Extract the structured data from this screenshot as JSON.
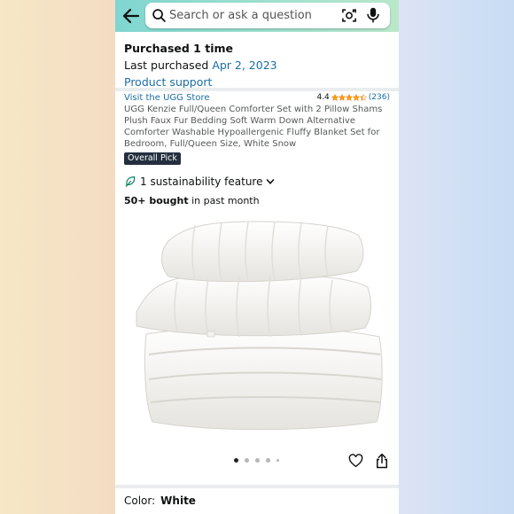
{
  "search": {
    "placeholder": "Search or ask a question",
    "value": ""
  },
  "purchase": {
    "count_text": "Purchased 1 time",
    "last_label": "Last purchased",
    "last_date": "Apr 2, 2023",
    "support_link": "Product support"
  },
  "product": {
    "store_link": "Visit the UGG Store",
    "rating_value": "4.4",
    "rating_stars": 4.4,
    "review_count": "(236)",
    "title": "UGG Kenzie Full/Queen Comforter Set with 2 Pillow Shams Plush Faux Fur Bedding Soft Warm Down Alternative Comforter Washable Hypoallergenic Fluffy Blanket Set for Bedroom, Full/Queen Size, White Snow",
    "badge": "Overall Pick",
    "sustainability": "1 sustainability feature",
    "bought_bold": "50+ bought",
    "bought_rest": " in past month"
  },
  "gallery": {
    "image_count": 5,
    "active_index": 0
  },
  "variation": {
    "label": "Color:",
    "value": "White"
  },
  "icons": {
    "back": "back-arrow-icon",
    "search": "search-icon",
    "camera": "camera-lens-icon",
    "mic": "microphone-icon",
    "leaf": "leaf-icon",
    "chevron": "chevron-down-icon",
    "star": "star-icon",
    "heart": "heart-icon",
    "share": "share-icon"
  },
  "colors": {
    "link": "#1a6ea5",
    "star": "#ff9f00",
    "badge_bg": "#232f3e",
    "leaf": "#067d62"
  }
}
